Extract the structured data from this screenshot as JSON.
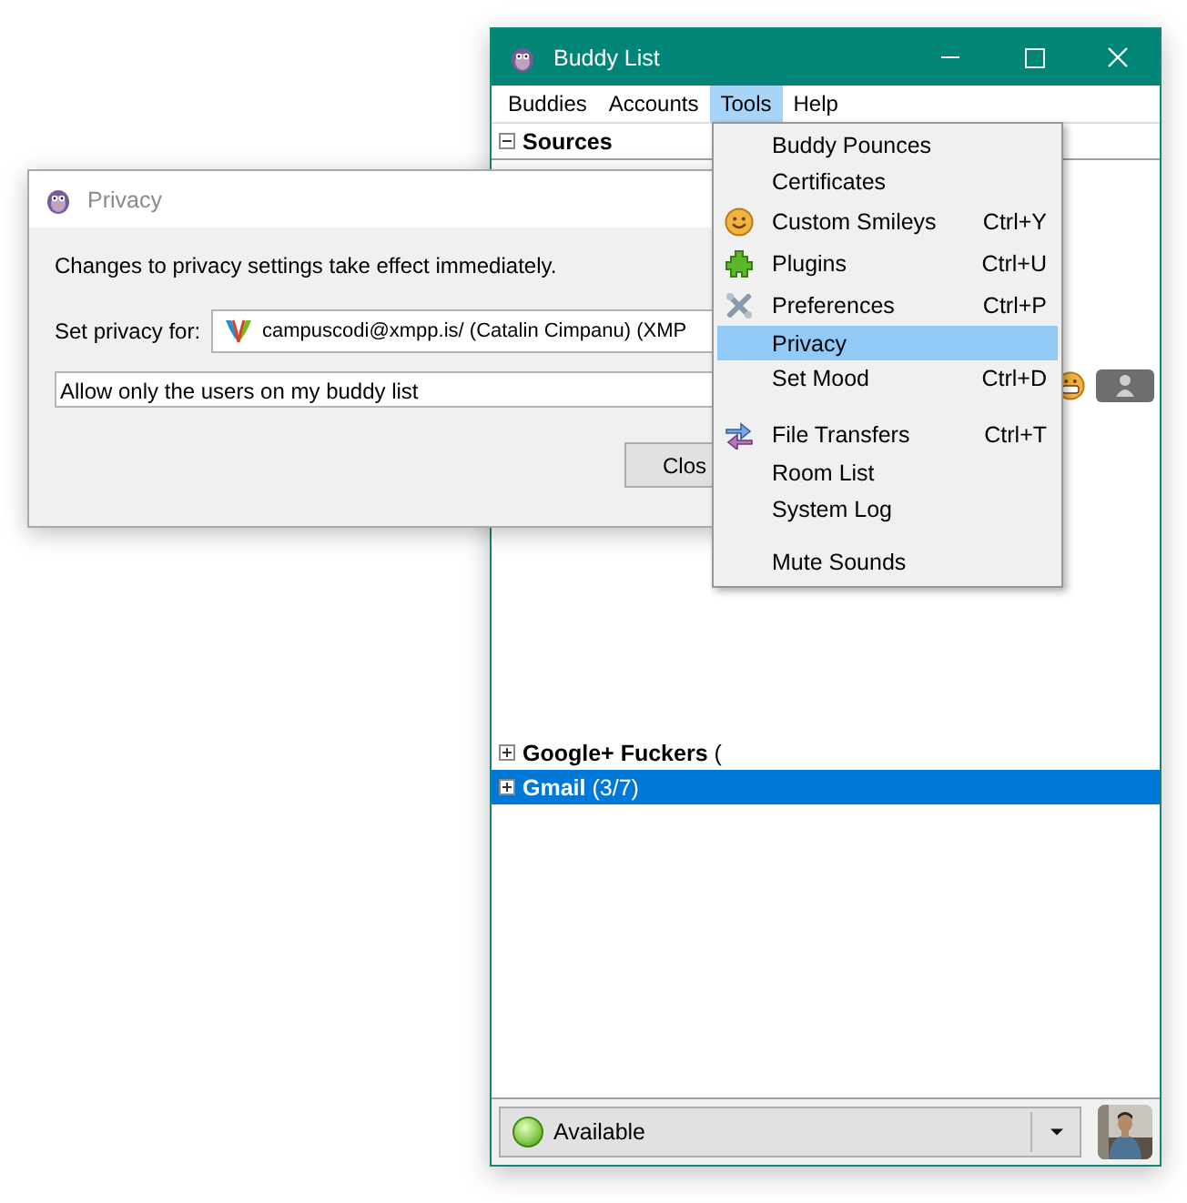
{
  "dialog": {
    "title": "Privacy",
    "message": "Changes to privacy settings take effect immediately.",
    "account_label": "Set privacy for:",
    "account": "campuscodi@xmpp.is/ (Catalin Cimpanu) (XMP",
    "mode": "Allow only the users on my buddy list",
    "close_button": "Clos"
  },
  "buddy_window": {
    "title": "Buddy List",
    "menu": [
      {
        "label": "Buddies",
        "selected": false
      },
      {
        "label": "Accounts",
        "selected": false
      },
      {
        "label": "Tools",
        "selected": true
      },
      {
        "label": "Help",
        "selected": false
      }
    ],
    "groups": [
      {
        "name": "Sources",
        "expanded": true,
        "selected": false
      },
      {
        "name": "Google+ Fuckers",
        "count": "(",
        "expanded": false,
        "selected": false
      },
      {
        "name": "Gmail",
        "count": "(3/7)",
        "expanded": false,
        "selected": true
      }
    ],
    "status": "Available"
  },
  "tools_menu": [
    {
      "kind": "plain",
      "label": "Buddy Pounces",
      "selected": false
    },
    {
      "kind": "plain",
      "label": "Certificates",
      "selected": false
    },
    {
      "kind": "smiley",
      "label": "Custom Smileys",
      "shortcut": "Ctrl+Y",
      "selected": false
    },
    {
      "kind": "plugin",
      "label": "Plugins",
      "shortcut": "Ctrl+U",
      "selected": false
    },
    {
      "kind": "tools",
      "label": "Preferences",
      "shortcut": "Ctrl+P",
      "selected": false
    },
    {
      "kind": "plain",
      "label": "Privacy",
      "selected": true
    },
    {
      "kind": "plain",
      "label": "Set Mood",
      "shortcut": "Ctrl+D",
      "selected": false
    },
    {
      "kind": "separator"
    },
    {
      "kind": "transfer",
      "label": "File Transfers",
      "shortcut": "Ctrl+T",
      "selected": false
    },
    {
      "kind": "plain",
      "label": "Room List",
      "selected": false
    },
    {
      "kind": "plain",
      "label": "System Log",
      "selected": false
    },
    {
      "kind": "separator"
    },
    {
      "kind": "plain",
      "label": "Mute Sounds",
      "selected": false
    }
  ]
}
